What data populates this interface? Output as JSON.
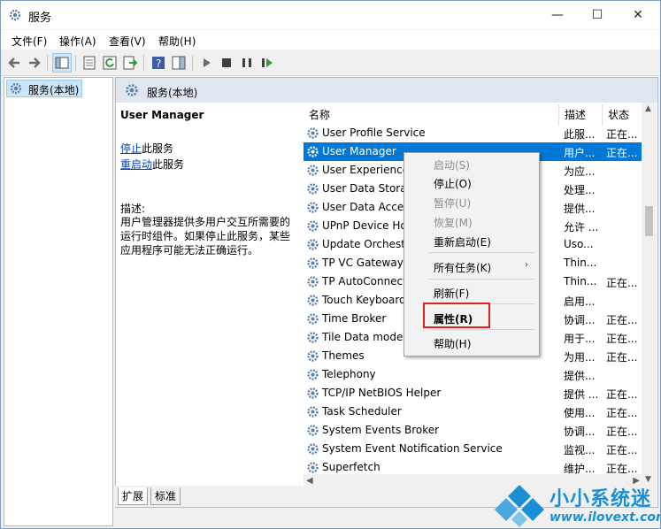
{
  "window": {
    "title": "服务",
    "controls": {
      "minimize": "—",
      "maximize": "☐",
      "close": "✕"
    }
  },
  "menubar": [
    "文件(F)",
    "操作(A)",
    "查看(V)",
    "帮助(H)"
  ],
  "tree": {
    "root": "服务(本地)"
  },
  "pane": {
    "header": "服务(本地)",
    "selected_service": "User Manager",
    "action_stop_link": "停止",
    "action_stop_suffix": "此服务",
    "action_restart_link": "重启动",
    "action_restart_suffix": "此服务",
    "desc_label": "描述:",
    "desc_text": "用户管理器提供多用户交互所需要的运行时组件。如果停止此服务，某些应用程序可能无法正确运行。"
  },
  "columns": {
    "name": "名称",
    "desc": "描述",
    "status": "状态"
  },
  "services": [
    {
      "name": "User Profile Service",
      "desc": "此服...",
      "status": "正在..."
    },
    {
      "name": "User Manager",
      "desc": "用户...",
      "status": "正在..."
    },
    {
      "name": "User Experience",
      "desc": "为应...",
      "status": ""
    },
    {
      "name": "User Data Stora",
      "desc": "处理...",
      "status": ""
    },
    {
      "name": "User Data Acce",
      "desc": "提供...",
      "status": ""
    },
    {
      "name": "UPnP Device Ho",
      "desc": "允许 ...",
      "status": ""
    },
    {
      "name": "Update Orchest",
      "desc": "Uso...",
      "status": ""
    },
    {
      "name": "TP VC Gateway",
      "desc": "Thin...",
      "status": ""
    },
    {
      "name": "TP AutoConnect",
      "desc": "Thin...",
      "status": "正在..."
    },
    {
      "name": "Touch Keyboard",
      "desc": "启用...",
      "status": ""
    },
    {
      "name": "Time Broker",
      "desc": "协调...",
      "status": "正在..."
    },
    {
      "name": "Tile Data mode",
      "desc": "用于...",
      "status": "正在..."
    },
    {
      "name": "Themes",
      "desc": "为用...",
      "status": "正在..."
    },
    {
      "name": "Telephony",
      "desc": "提供...",
      "status": ""
    },
    {
      "name": "TCP/IP NetBIOS Helper",
      "desc": "提供 ...",
      "status": "正在..."
    },
    {
      "name": "Task Scheduler",
      "desc": "使用...",
      "status": "正在..."
    },
    {
      "name": "System Events Broker",
      "desc": "协调...",
      "status": "正在..."
    },
    {
      "name": "System Event Notification Service",
      "desc": "监视...",
      "status": "正在..."
    },
    {
      "name": "Superfetch",
      "desc": "维护...",
      "status": "正在..."
    }
  ],
  "context_menu": {
    "start": "启动(S)",
    "stop": "停止(O)",
    "pause": "暂停(U)",
    "resume": "恢复(M)",
    "restart": "重新启动(E)",
    "all_tasks": "所有任务(K)",
    "refresh": "刷新(F)",
    "properties": "属性(R)",
    "help": "帮助(H)",
    "highlight_color": "#e02020"
  },
  "tabs": [
    "扩展",
    "标准"
  ],
  "watermark": {
    "title": "小小系统迷",
    "url": "www.ilovext.com"
  },
  "colors": {
    "selection": "#0078d7",
    "link": "#0645ad",
    "brand": "#1a8fd6"
  }
}
